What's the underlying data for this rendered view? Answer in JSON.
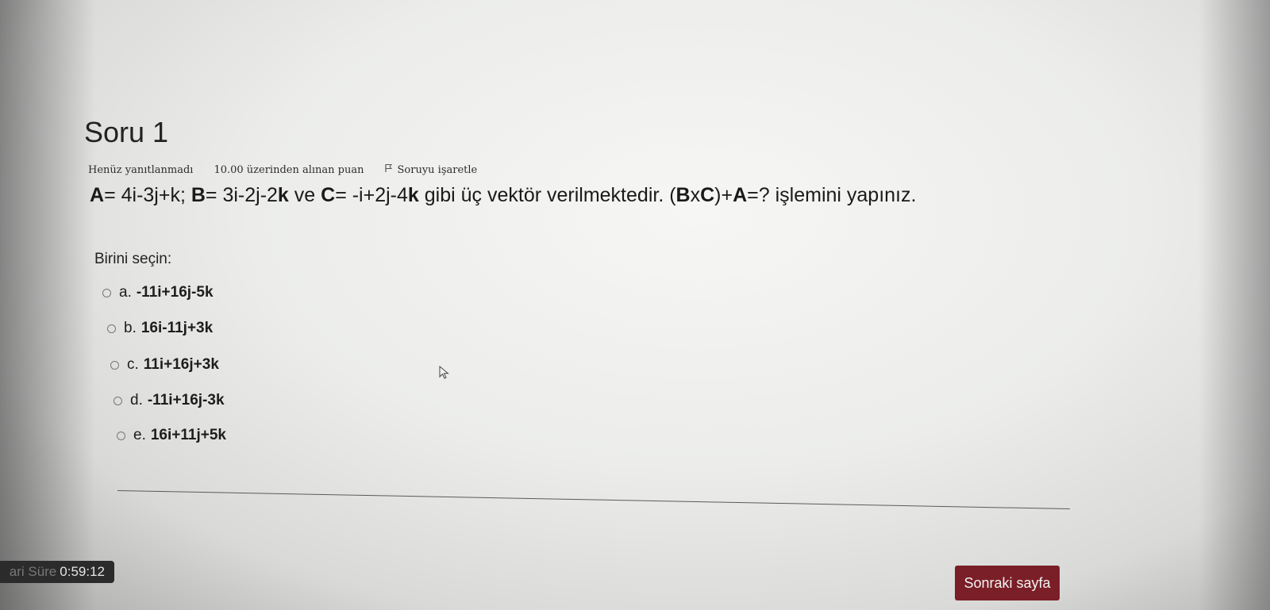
{
  "question": {
    "title": "Soru 1",
    "status": "Henüz yanıtlanmadı",
    "points": "10.00 üzerinden alınan puan",
    "flag_label": "Soruyu işaretle",
    "text_parts": {
      "a_label": "A",
      "a_value": "= 4i-3j+k; ",
      "b_label": "B",
      "b_value": "= 3i-2j-2",
      "b_k": "k",
      "ve": " ve ",
      "c_label": "C",
      "c_value": "= -i+2j-4",
      "c_k": "k",
      "middle": " gibi üç vektör verilmektedir. (",
      "bxc_b": "B",
      "bxc_x": "x",
      "bxc_c": "C",
      "plus": ")+",
      "a_label2": "A",
      "end": "=? işlemini yapınız."
    },
    "prompt": "Birini seçin:",
    "options": [
      {
        "letter": "a.",
        "answer": "-11i+16j-5k"
      },
      {
        "letter": "b.",
        "answer": "16i-11j+3k"
      },
      {
        "letter": "c.",
        "answer": "11i+16j+3k"
      },
      {
        "letter": "d.",
        "answer": "-11i+16j-3k"
      },
      {
        "letter": "e.",
        "answer": "16i+11j+5k"
      }
    ]
  },
  "footer": {
    "timer_label": "ari Süre",
    "timer_value": "0:59:12",
    "next_button": "Sonraki sayfa"
  },
  "colors": {
    "next_button_bg": "#7a1f27",
    "timer_bg": "#2b2b2b"
  },
  "icons": {
    "flag": "flag-icon",
    "cursor": "mouse-pointer-icon"
  }
}
